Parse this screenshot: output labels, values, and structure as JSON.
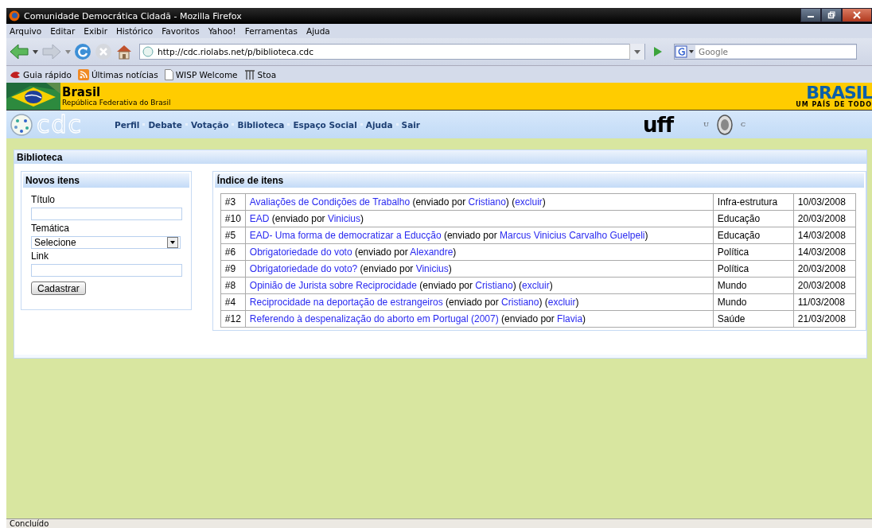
{
  "window": {
    "title": "Comunidade Democrática Cidadã - Mozilla Firefox"
  },
  "menu": [
    "Arquivo",
    "Editar",
    "Exibir",
    "Histórico",
    "Favoritos",
    "Yahoo!",
    "Ferramentas",
    "Ajuda"
  ],
  "address_bar": {
    "value": "http://cdc.riolabs.net/p/biblioteca.cdc"
  },
  "search": {
    "placeholder": "Google"
  },
  "bookmarks": [
    {
      "label": "Guia rápido",
      "kind": "page"
    },
    {
      "label": "Últimas notícias",
      "kind": "feed"
    },
    {
      "label": "WISP Welcome",
      "kind": "doc"
    },
    {
      "label": "Stoa",
      "kind": "stoa"
    }
  ],
  "gov_banner": {
    "title": "Brasil",
    "subtitle": "República Federativa do Brasil",
    "logo": "BRASIL",
    "tagline": "UM PAÍS DE TODO"
  },
  "site_nav": {
    "logo": "cdc",
    "items": [
      "Perfil",
      "Debate",
      "Votação",
      "Biblioteca",
      "Espaço Social",
      "Ajuda",
      "Sair"
    ],
    "partner_logo": "uff",
    "seal_left": "U",
    "seal_right": "C"
  },
  "page": {
    "title": "Biblioteca"
  },
  "form": {
    "title": "Novos itens",
    "fields": [
      {
        "label": "Título",
        "kind": "text"
      },
      {
        "label": "Temática",
        "kind": "select",
        "value": "Selecione"
      },
      {
        "label": "Link",
        "kind": "text"
      }
    ],
    "submit": "Cadastrar"
  },
  "index": {
    "title": "Índice de itens",
    "rows": [
      {
        "number": "#3",
        "parts": [
          {
            "text": "Avaliações de Condições de Trabalho",
            "link": true
          },
          {
            "text": " (enviado por ",
            "link": false
          },
          {
            "text": "Cristiano",
            "link": true
          },
          {
            "text": ") (",
            "link": false
          },
          {
            "text": "excluir",
            "link": true
          },
          {
            "text": ")",
            "link": false
          }
        ],
        "category": "Infra-estrutura",
        "date": "10/03/2008"
      },
      {
        "number": "#10",
        "parts": [
          {
            "text": "EAD",
            "link": true
          },
          {
            "text": " (enviado por ",
            "link": false
          },
          {
            "text": "Vinicius",
            "link": true
          },
          {
            "text": ")",
            "link": false
          }
        ],
        "category": "Educação",
        "date": "20/03/2008"
      },
      {
        "number": "#5",
        "parts": [
          {
            "text": "EAD- Uma forma de democratizar a Educção",
            "link": true
          },
          {
            "text": " (enviado por ",
            "link": false
          },
          {
            "text": "Marcus Vinicius Carvalho Guelpeli",
            "link": true
          },
          {
            "text": ")",
            "link": false
          }
        ],
        "category": "Educação",
        "date": "14/03/2008"
      },
      {
        "number": "#6",
        "parts": [
          {
            "text": "Obrigatoriedade do voto",
            "link": true
          },
          {
            "text": " (enviado por ",
            "link": false
          },
          {
            "text": "Alexandre",
            "link": true
          },
          {
            "text": ")",
            "link": false
          }
        ],
        "category": "Política",
        "date": "14/03/2008"
      },
      {
        "number": "#9",
        "parts": [
          {
            "text": "Obrigatoriedade do voto?",
            "link": true
          },
          {
            "text": " (enviado por ",
            "link": false
          },
          {
            "text": "Vinicius",
            "link": true
          },
          {
            "text": ")",
            "link": false
          }
        ],
        "category": "Política",
        "date": "20/03/2008"
      },
      {
        "number": "#8",
        "parts": [
          {
            "text": "Opinião de Jurista sobre Reciprocidade",
            "link": true
          },
          {
            "text": " (enviado por ",
            "link": false
          },
          {
            "text": "Cristiano",
            "link": true
          },
          {
            "text": ") (",
            "link": false
          },
          {
            "text": "excluir",
            "link": true
          },
          {
            "text": ")",
            "link": false
          }
        ],
        "category": "Mundo",
        "date": "20/03/2008"
      },
      {
        "number": "#4",
        "parts": [
          {
            "text": "Reciprocidade na deportação de estrangeiros",
            "link": true
          },
          {
            "text": " (enviado por ",
            "link": false
          },
          {
            "text": "Cristiano",
            "link": true
          },
          {
            "text": ") (",
            "link": false
          },
          {
            "text": "excluir",
            "link": true
          },
          {
            "text": ")",
            "link": false
          }
        ],
        "category": "Mundo",
        "date": "11/03/2008"
      },
      {
        "number": "#12",
        "parts": [
          {
            "text": "Referendo à despenalização do aborto em Portugal (2007)",
            "link": true
          },
          {
            "text": " (enviado por ",
            "link": false
          },
          {
            "text": "Flavia",
            "link": true
          },
          {
            "text": ")",
            "link": false
          }
        ],
        "category": "Saúde",
        "date": "21/03/2008"
      }
    ]
  },
  "status_bar": {
    "text": "Concluído"
  }
}
